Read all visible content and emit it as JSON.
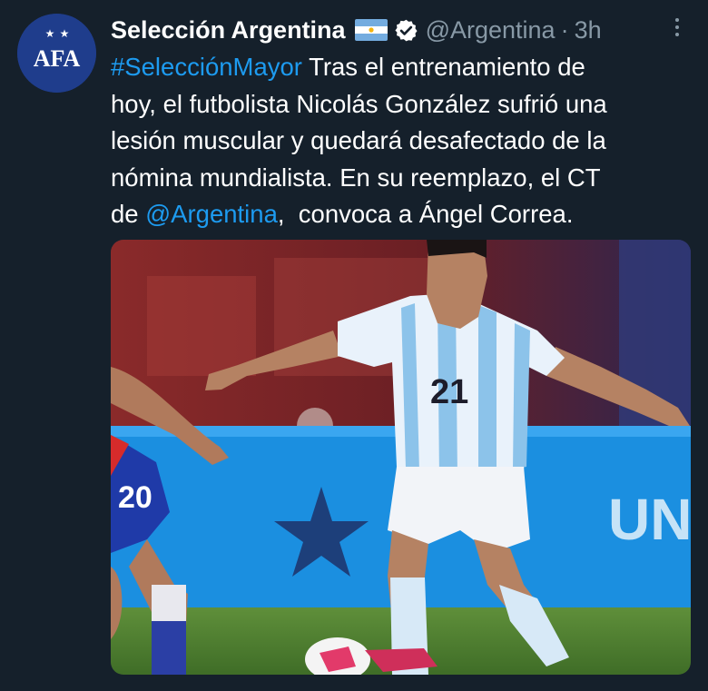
{
  "author": {
    "name": "Selección Argentina",
    "handle": "@Argentina",
    "separator": "·",
    "time": "3h",
    "avatar_logo": "AFA"
  },
  "tweet": {
    "lines": [
      {
        "hashtag": "#SelecciónMayor",
        "text": " Tras el entrenamiento de"
      },
      {
        "text": "hoy, el futbolista Nicolás González sufrió una"
      },
      {
        "text": "lesión muscular y quedará desafectado de la"
      },
      {
        "text": "nómina mundialista. En su reemplazo, el CT"
      },
      {
        "pre": "de ",
        "mention": "@Argentina",
        "post": ",  convoca a Ángel Correa."
      }
    ]
  },
  "media": {
    "jersey_number": "21",
    "opponent_number": "20",
    "banner_text": "UNA"
  },
  "icons": {
    "flag": "argentina-flag-icon",
    "verified": "verified-badge-icon",
    "more": "more-options-icon"
  },
  "colors": {
    "background": "#15202b",
    "link": "#1d9bf0",
    "secondary_text": "#8899a6",
    "avatar_bg": "#1f3d8c"
  }
}
